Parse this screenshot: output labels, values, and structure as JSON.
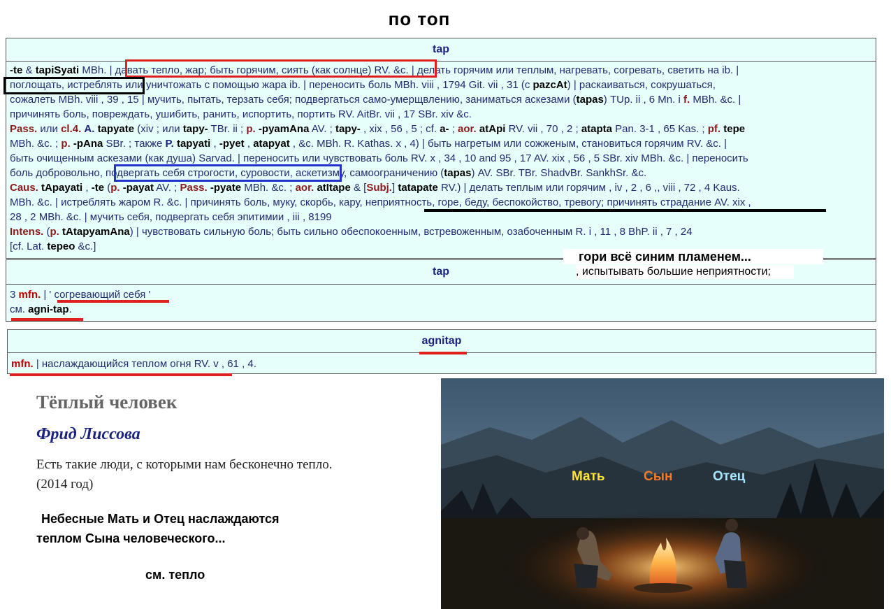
{
  "page": {
    "heading": "по   топ"
  },
  "entry1": {
    "title": "tap",
    "lines": {
      "l1": [
        {
          "t": "-te",
          "c": "b"
        },
        {
          "t": " & "
        },
        {
          "t": "tapiSyati",
          "c": "b"
        },
        {
          "t": " MBh. | давать тепло, жар; быть горячим, сиять (как солнце) RV. &c. | делать горячим или теплым, нагревать, согревать, светить на ib. |"
        }
      ],
      "l2": [
        {
          "t": "поглощать, истреблять или уничтожать с помощью жара ib. | переносить боль MBh. viii , 1794 Git. vii , 31 (с "
        },
        {
          "t": "pazcAt",
          "c": "b"
        },
        {
          "t": ") | раскаиваться, сокрушаться,"
        }
      ],
      "l3": [
        {
          "t": "сожалеть MBh. viii , 39 , 15 | мучить, пытать, терзать себя; подвергаться само-умерщвлению, заниматься аскезами ("
        },
        {
          "t": "tapas",
          "c": "b"
        },
        {
          "t": ") TUp. ii , 6 Mn. i "
        },
        {
          "t": "f.",
          "c": "g"
        },
        {
          "t": " MBh. &c. |"
        }
      ],
      "l4": [
        {
          "t": "причинять боль, повреждать, ушибить, ранить, испортить, портить RV. AitBr. vii , 17 SBr. xiv &c."
        }
      ],
      "l5": [
        {
          "t": "Pass.",
          "c": "g"
        },
        {
          "t": " или "
        },
        {
          "t": "cl.4.",
          "c": "g"
        },
        {
          "t": " "
        },
        {
          "t": "A.",
          "c": "bl"
        },
        {
          "t": " "
        },
        {
          "t": "tapyate",
          "c": "b"
        },
        {
          "t": " (xiv ; или "
        },
        {
          "t": "tapy-",
          "c": "b"
        },
        {
          "t": " TBr. ii ; "
        },
        {
          "t": "p.",
          "c": "g"
        },
        {
          "t": " "
        },
        {
          "t": "-pyamAna",
          "c": "b"
        },
        {
          "t": " AV. ; "
        },
        {
          "t": "tapy-",
          "c": "b"
        },
        {
          "t": " , xix , 56 , 5 ; cf. "
        },
        {
          "t": "a-",
          "c": "b"
        },
        {
          "t": " ; "
        },
        {
          "t": "aor.",
          "c": "g"
        },
        {
          "t": " "
        },
        {
          "t": "atApi",
          "c": "b"
        },
        {
          "t": " RV. vii , 70 , 2 ; "
        },
        {
          "t": "atapta",
          "c": "b"
        },
        {
          "t": " Pan. 3-1 , 65 Kas. ; "
        },
        {
          "t": "pf.",
          "c": "g"
        },
        {
          "t": " "
        },
        {
          "t": "tepe",
          "c": "b"
        }
      ],
      "l6": [
        {
          "t": "MBh. &c. ; "
        },
        {
          "t": "p.",
          "c": "g"
        },
        {
          "t": " "
        },
        {
          "t": "-pAna",
          "c": "b"
        },
        {
          "t": " SBr. ; также "
        },
        {
          "t": "P.",
          "c": "bl"
        },
        {
          "t": " "
        },
        {
          "t": "tapyati",
          "c": "b"
        },
        {
          "t": " , "
        },
        {
          "t": "-pyet",
          "c": "b"
        },
        {
          "t": " , "
        },
        {
          "t": "atapyat",
          "c": "b"
        },
        {
          "t": " , &c. MBh. R. Kathas. x , 4) | быть нагретым или сожженым, становиться горячим RV. &c. |"
        }
      ],
      "l7": [
        {
          "t": "быть очищенным аскезами (как душа) Sarvad. | переносить или чувствовать боль RV. x , 34 , 10 and 95 , 17 AV. xix , 56 , 5 SBr. xiv MBh. &c. | переносить"
        }
      ],
      "l8": [
        {
          "t": "боль добровольно, подвергать себя строгости, суровости, аскетизму, самоограничению ("
        },
        {
          "t": "tapas",
          "c": "b"
        },
        {
          "t": ") AV. SBr. TBr. ShadvBr. SankhSr. &c."
        }
      ],
      "l9": [
        {
          "t": "Caus.",
          "c": "g"
        },
        {
          "t": " "
        },
        {
          "t": "tApayati",
          "c": "b"
        },
        {
          "t": " , "
        },
        {
          "t": "-te",
          "c": "b"
        },
        {
          "t": " ("
        },
        {
          "t": "p.",
          "c": "g"
        },
        {
          "t": " "
        },
        {
          "t": "-payat",
          "c": "b"
        },
        {
          "t": " AV. ; "
        },
        {
          "t": "Pass.",
          "c": "g"
        },
        {
          "t": " "
        },
        {
          "t": "-pyate",
          "c": "b"
        },
        {
          "t": " MBh. &c. ; "
        },
        {
          "t": "aor.",
          "c": "g"
        },
        {
          "t": " "
        },
        {
          "t": "atItape",
          "c": "b"
        },
        {
          "t": " & ["
        },
        {
          "t": "Subj.",
          "c": "g"
        },
        {
          "t": "] "
        },
        {
          "t": "tatapate",
          "c": "b"
        },
        {
          "t": " RV.) | делать теплым или горячим , iv , 2 , 6 ,, viii , 72 , 4 Kaus."
        }
      ],
      "l10": [
        {
          "t": "MBh. &c. | истреблять жаром R. &c. | причинять боль, муку, скорбь, кару, неприятность, горе, беду, беспокойство, тревогу; причинять страдание AV. xix ,"
        }
      ],
      "l11": [
        {
          "t": "28 , 2 MBh. &c. | мучить себя, подвергать себя эпитимии , iii , 8199"
        }
      ],
      "l12": [
        {
          "t": "Intens.",
          "c": "g"
        },
        {
          "t": " ("
        },
        {
          "t": "p.",
          "c": "g"
        },
        {
          "t": " "
        },
        {
          "t": "tAtapyamAna",
          "c": "b"
        },
        {
          "t": ") | чувствовать сильную боль; быть сильно обеспокоенным, встревоженным, озабоченным R. i , 11 , 8 BhP. ii , 7 , 24"
        }
      ],
      "l13": [
        {
          "t": "[cf. Lat. "
        },
        {
          "t": "tepeo",
          "c": "b"
        },
        {
          "t": " &c.]"
        }
      ]
    }
  },
  "entry2": {
    "title": "tap",
    "lines": {
      "l1": [
        {
          "t": "3 "
        },
        {
          "t": "mfn.",
          "c": "rd"
        },
        {
          "t": " | ' согревающий себя '"
        }
      ],
      "l2": [
        {
          "t": "см. "
        },
        {
          "t": "agni-tap",
          "c": "b"
        },
        {
          "t": "."
        }
      ]
    }
  },
  "entry3": {
    "title": "agnitap",
    "lines": {
      "l1": [
        {
          "t": "mfn.",
          "c": "rd"
        },
        {
          "t": " | наслаждающийся теплом огня RV. v , 61 , 4."
        }
      ]
    }
  },
  "overlay": {
    "caption_bold": "гори всё синим пламенем...",
    "caption_plain": ", испытывать большие неприятности;"
  },
  "article": {
    "title": "Тёплый человек",
    "author": "Фрид Лиссова",
    "text": "Есть такие люди, с которыми нам бесконечно тепло.",
    "year": "(2014 год)"
  },
  "notes": {
    "heavenly_line1": "Небесные Мать и Отец наслаждаются",
    "heavenly_line2": "теплом Сына человеческого...",
    "see_warm": "см. тепло"
  },
  "photo": {
    "label_mother": "Мать",
    "label_son": "Сын",
    "label_father": "Отец",
    "colors": {
      "mother": "#ffe23a",
      "son": "#f07a2a",
      "father": "#a8e6ff"
    }
  },
  "colors": {
    "box_bg": "#e6fffb",
    "frame_red": "#e02020",
    "frame_blue": "#2233cc",
    "frame_black": "#000000"
  }
}
